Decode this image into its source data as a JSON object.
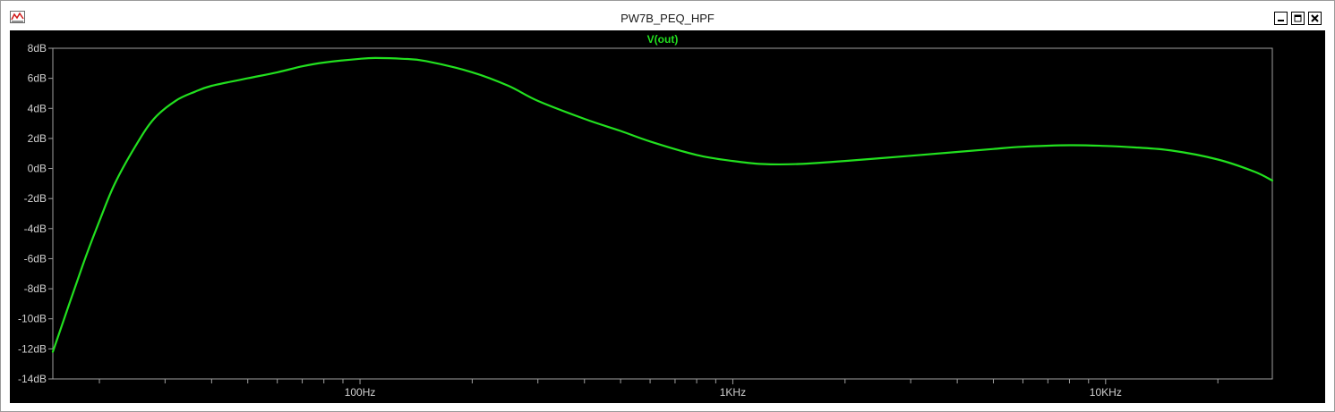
{
  "window": {
    "title": "PW7B_PEQ_HPF",
    "controls": [
      "minimize",
      "maximize",
      "close"
    ],
    "app_icon": "waveform-chart-icon"
  },
  "colors": {
    "plot_background": "#000000",
    "frame": "#a0a0a0",
    "trace": "#22e01f",
    "tick_text": "#cfcfcf"
  },
  "chart_data": {
    "type": "line",
    "title": "",
    "xlabel": "",
    "ylabel": "",
    "x_scale": "log",
    "xlim": [
      15,
      28000
    ],
    "ylim": [
      -14,
      8
    ],
    "grid": false,
    "legend": "top-center",
    "x_tick_labels": [
      {
        "value": 100,
        "label": "100Hz"
      },
      {
        "value": 1000,
        "label": "1KHz"
      },
      {
        "value": 10000,
        "label": "10KHz"
      }
    ],
    "y_tick_labels": [
      {
        "value": 8,
        "label": "8dB"
      },
      {
        "value": 6,
        "label": "6dB"
      },
      {
        "value": 4,
        "label": "4dB"
      },
      {
        "value": 2,
        "label": "2dB"
      },
      {
        "value": 0,
        "label": "0dB"
      },
      {
        "value": -2,
        "label": "-2dB"
      },
      {
        "value": -4,
        "label": "-4dB"
      },
      {
        "value": -6,
        "label": "-6dB"
      },
      {
        "value": -8,
        "label": "-8dB"
      },
      {
        "value": -10,
        "label": "-10dB"
      },
      {
        "value": -12,
        "label": "-12dB"
      },
      {
        "value": -14,
        "label": "-14dB"
      }
    ],
    "series": [
      {
        "name": "V(out)",
        "color": "#22e01f",
        "points": [
          [
            15,
            -12.2
          ],
          [
            18,
            -6.5
          ],
          [
            20,
            -3.5
          ],
          [
            22,
            -1.0
          ],
          [
            25,
            1.5
          ],
          [
            28,
            3.3
          ],
          [
            32,
            4.5
          ],
          [
            36,
            5.1
          ],
          [
            40,
            5.5
          ],
          [
            50,
            6.0
          ],
          [
            60,
            6.4
          ],
          [
            70,
            6.8
          ],
          [
            80,
            7.05
          ],
          [
            100,
            7.3
          ],
          [
            110,
            7.35
          ],
          [
            130,
            7.3
          ],
          [
            150,
            7.15
          ],
          [
            200,
            6.4
          ],
          [
            250,
            5.5
          ],
          [
            300,
            4.5
          ],
          [
            400,
            3.3
          ],
          [
            500,
            2.5
          ],
          [
            600,
            1.8
          ],
          [
            800,
            0.9
          ],
          [
            1000,
            0.5
          ],
          [
            1200,
            0.3
          ],
          [
            1500,
            0.3
          ],
          [
            2000,
            0.5
          ],
          [
            3000,
            0.85
          ],
          [
            4000,
            1.1
          ],
          [
            5000,
            1.3
          ],
          [
            6000,
            1.45
          ],
          [
            8000,
            1.55
          ],
          [
            10000,
            1.5
          ],
          [
            12000,
            1.4
          ],
          [
            15000,
            1.2
          ],
          [
            20000,
            0.6
          ],
          [
            25000,
            -0.2
          ],
          [
            28000,
            -0.8
          ]
        ]
      }
    ]
  }
}
